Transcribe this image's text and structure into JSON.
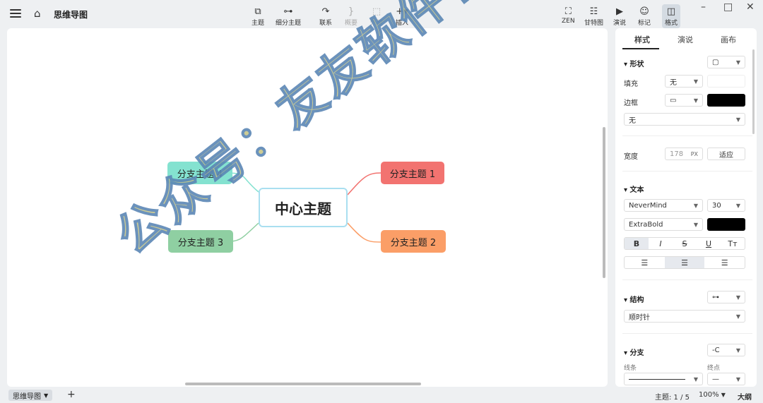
{
  "header": {
    "title": "思维导图",
    "toolbar": [
      {
        "id": "topic",
        "label": "主题",
        "icon": "topic-icon",
        "glyph": "⧉",
        "enabled": true
      },
      {
        "id": "subtopic",
        "label": "细分主题",
        "icon": "subtopic-icon",
        "glyph": "⊶",
        "enabled": true
      },
      {
        "id": "relation",
        "label": "联系",
        "icon": "relation-icon",
        "glyph": "↷",
        "enabled": true
      },
      {
        "id": "summary",
        "label": "概要",
        "icon": "summary-icon",
        "glyph": "}",
        "enabled": false
      },
      {
        "id": "boundary",
        "label": "外框",
        "icon": "boundary-icon",
        "glyph": "⬚",
        "enabled": false
      },
      {
        "id": "insert",
        "label": "插入",
        "icon": "plus-icon",
        "glyph": "+▾",
        "enabled": true
      }
    ],
    "right_tools": [
      {
        "id": "zen",
        "label": "ZEN",
        "icon": "fullscreen-icon",
        "glyph": "⛶"
      },
      {
        "id": "gantt",
        "label": "甘特图",
        "icon": "gantt-icon",
        "glyph": "☷"
      },
      {
        "id": "present",
        "label": "演说",
        "icon": "play-icon",
        "glyph": "▶"
      },
      {
        "id": "marker",
        "label": "标记",
        "icon": "smiley-icon",
        "glyph": "☺"
      },
      {
        "id": "format",
        "label": "格式",
        "icon": "format-panel-icon",
        "glyph": "◫"
      }
    ],
    "window_controls": {
      "minimize": "–",
      "maximize": "□",
      "close": "✕"
    }
  },
  "canvas": {
    "center": "中心主题",
    "branches": [
      {
        "label": "分支主题 1",
        "color": "#f27370"
      },
      {
        "label": "分支主题 2",
        "color": "#fb9e67"
      },
      {
        "label": "分支主题 3",
        "color": "#8fcfa2"
      },
      {
        "label": "分支主题 4",
        "color": "#84e2d0"
      }
    ]
  },
  "panel": {
    "tabs": [
      "样式",
      "演说",
      "画布"
    ],
    "shape": {
      "title": "形状"
    },
    "fill": {
      "label": "填充",
      "value": "无"
    },
    "border": {
      "label": "边框",
      "color": "#000000",
      "style_value": "无"
    },
    "width": {
      "label": "宽度",
      "value": "178",
      "unit": "PX",
      "button": "适应"
    },
    "text": {
      "title": "文本",
      "font": "NeverMind",
      "size": "30",
      "weight": "ExtraBold",
      "color": "#000000",
      "styles": [
        "B",
        "I",
        "S",
        "U",
        "Tт"
      ]
    },
    "structure": {
      "title": "结构",
      "value": "顺时针"
    },
    "branch": {
      "title": "分支",
      "line_label": "线条",
      "end_label": "终点"
    }
  },
  "status": {
    "sheet": "思维导图",
    "topics": "主题: 1 / 5",
    "zoom": "100%",
    "outline": "大纲"
  },
  "watermark": "公众号：友友软件管家"
}
